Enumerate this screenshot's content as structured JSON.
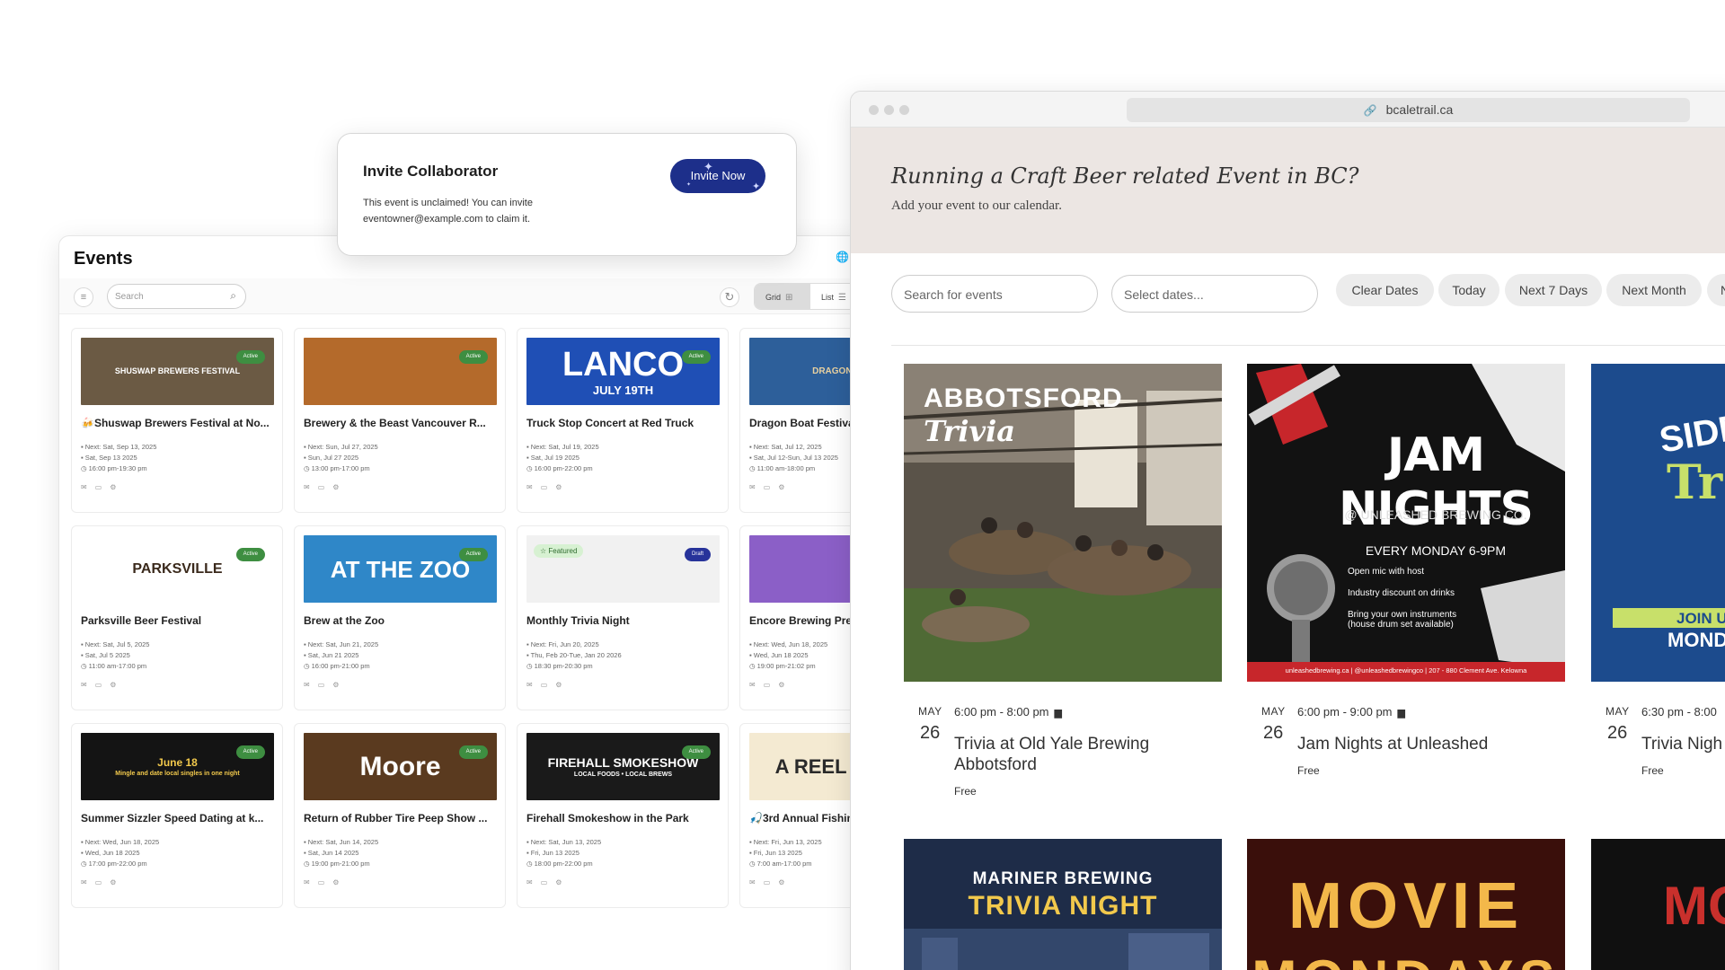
{
  "invite": {
    "title": "Invite Collaborator",
    "text": "This event is unclaimed! You can invite eventowner@example.com to claim it.",
    "button": "Invite Now"
  },
  "admin": {
    "title": "Events",
    "search_placeholder": "Search",
    "view_grid": "Grid",
    "view_list": "List",
    "cards": [
      {
        "title": "🍻Shuswap Brewers Festival at No...",
        "next": "Next: Sat, Sep 13, 2025",
        "dates": "Sat, Sep 13 2025",
        "time": "16:00 pm-19:30 pm",
        "status": "Active",
        "art": "SHUSWAP BREWERS FESTIVAL"
      },
      {
        "title": "Brewery & the Beast Vancouver R...",
        "next": "Next: Sun, Jul 27, 2025",
        "dates": "Sun, Jul 27 2025",
        "time": "13:00 pm-17:00 pm",
        "status": "Active",
        "art": ""
      },
      {
        "title": "Truck Stop Concert at Red Truck",
        "next": "Next: Sat, Jul 19, 2025",
        "dates": "Sat, Jul 19 2025",
        "time": "16:00 pm-22:00 pm",
        "status": "Active",
        "art": "LANCO",
        "art2": "JULY 19TH"
      },
      {
        "title": "Dragon Boat Festiva...",
        "next": "Next: Sat, Jul 12, 2025",
        "dates": "Sat, Jul 12-Sun, Jul 13 2025",
        "time": "11:00 am-18:00 pm",
        "status": "",
        "art": "DRAGON BOAT"
      },
      {
        "title": "Parksville Beer Festival",
        "next": "Next: Sat, Jul 5, 2025",
        "dates": "Sat, Jul 5 2025",
        "time": "11:00 am-17:00 pm",
        "status": "Active",
        "art": "PARKSVILLE"
      },
      {
        "title": "Brew at the Zoo",
        "next": "Next: Sat, Jun 21, 2025",
        "dates": "Sat, Jun 21 2025",
        "time": "16:00 pm-21:00 pm",
        "status": "Active",
        "art": "AT THE ZOO"
      },
      {
        "title": "Monthly Trivia Night",
        "next": "Next: Fri, Jun 20, 2025",
        "dates": "Thu, Feb 20-Tue, Jan 20 2026",
        "time": "18:30 pm-20:30 pm",
        "status": "Draft",
        "featured": "☆ Featured",
        "art": ""
      },
      {
        "title": "Encore Brewing Pre...",
        "next": "Next: Wed, Jun 18, 2025",
        "dates": "Wed, Jun 18 2025",
        "time": "19:00 pm-21:02 pm",
        "status": "",
        "art": ""
      },
      {
        "title": "Summer Sizzler Speed Dating at k...",
        "next": "Next: Wed, Jun 18, 2025",
        "dates": "Wed, Jun 18 2025",
        "time": "17:00 pm-22:00 pm",
        "status": "Active",
        "art": "June 18",
        "art2": "Mingle and date local singles in one night"
      },
      {
        "title": "Return of Rubber Tire Peep Show ...",
        "next": "Next: Sat, Jun 14, 2025",
        "dates": "Sat, Jun 14 2025",
        "time": "19:00 pm-21:00 pm",
        "status": "Active",
        "art": "Moore"
      },
      {
        "title": "Firehall Smokeshow in the Park",
        "next": "Next: Sat, Jun 13, 2025",
        "dates": "Fri, Jun 13 2025",
        "time": "18:00 pm-22:00 pm",
        "status": "Active",
        "art": "FIREHALL SMOKESHOW",
        "art2": "LOCAL FOODS • LOCAL BREWS"
      },
      {
        "title": "🎣3rd Annual Fishin...",
        "next": "Next: Fri, Jun 13, 2025",
        "dates": "Fri, Jun 13 2025",
        "time": "7:00 am-17:00 pm",
        "status": "",
        "art": "A REEL FISHIN"
      }
    ]
  },
  "browser": {
    "url": "bcaletrail.ca",
    "hero_title": "Running a Craft Beer related Event in BC?",
    "hero_sub": "Add your event to our calendar.",
    "search_placeholder": "Search for events",
    "dates_placeholder": "Select dates...",
    "chips": [
      "Clear Dates",
      "Today",
      "Next 7 Days",
      "Next Month",
      "N"
    ],
    "events": [
      {
        "month": "MAY",
        "day": "26",
        "time": "6:00 pm - 8:00 pm",
        "title": "Trivia at Old Yale Brewing Abbotsford",
        "price": "Free",
        "art": "ABBOTSFORD",
        "art2": "Trivia"
      },
      {
        "month": "MAY",
        "day": "26",
        "time": "6:00 pm - 9:00 pm",
        "title": "Jam Nights at Unleashed",
        "price": "Free",
        "art": "JAM NIGHTS",
        "art2": "@ UNLEASHED BREWING CO.",
        "art3": "EVERY MONDAY 6-9PM",
        "art4": "Open mic with host",
        "art5": "Industry discount on drinks",
        "art6": "Bring your own instruments (house drum set available)",
        "art7": "unleashedbrewing.ca | @unleashedbrewingco | 207 - 880 Clement Ave. Kelowna"
      },
      {
        "month": "MAY",
        "day": "26",
        "time": "6:30 pm - 8:00",
        "title": "Trivia Nigh",
        "price": "Free",
        "art": "SIDE",
        "art2": "Tr",
        "art3": "JOIN U",
        "art4": "MOND"
      }
    ],
    "more_events": [
      {
        "art": "MARINER BREWING",
        "art2": "TRIVIA NIGHT"
      },
      {
        "art": "MOVIE",
        "art2": "MONDAYS"
      },
      {
        "art": "MO"
      }
    ]
  },
  "colors": {
    "accent": "#1d2f8a",
    "active_badge": "#3e8e41",
    "hero_bg": "#ece6e3",
    "chip_bg": "#ececec"
  }
}
